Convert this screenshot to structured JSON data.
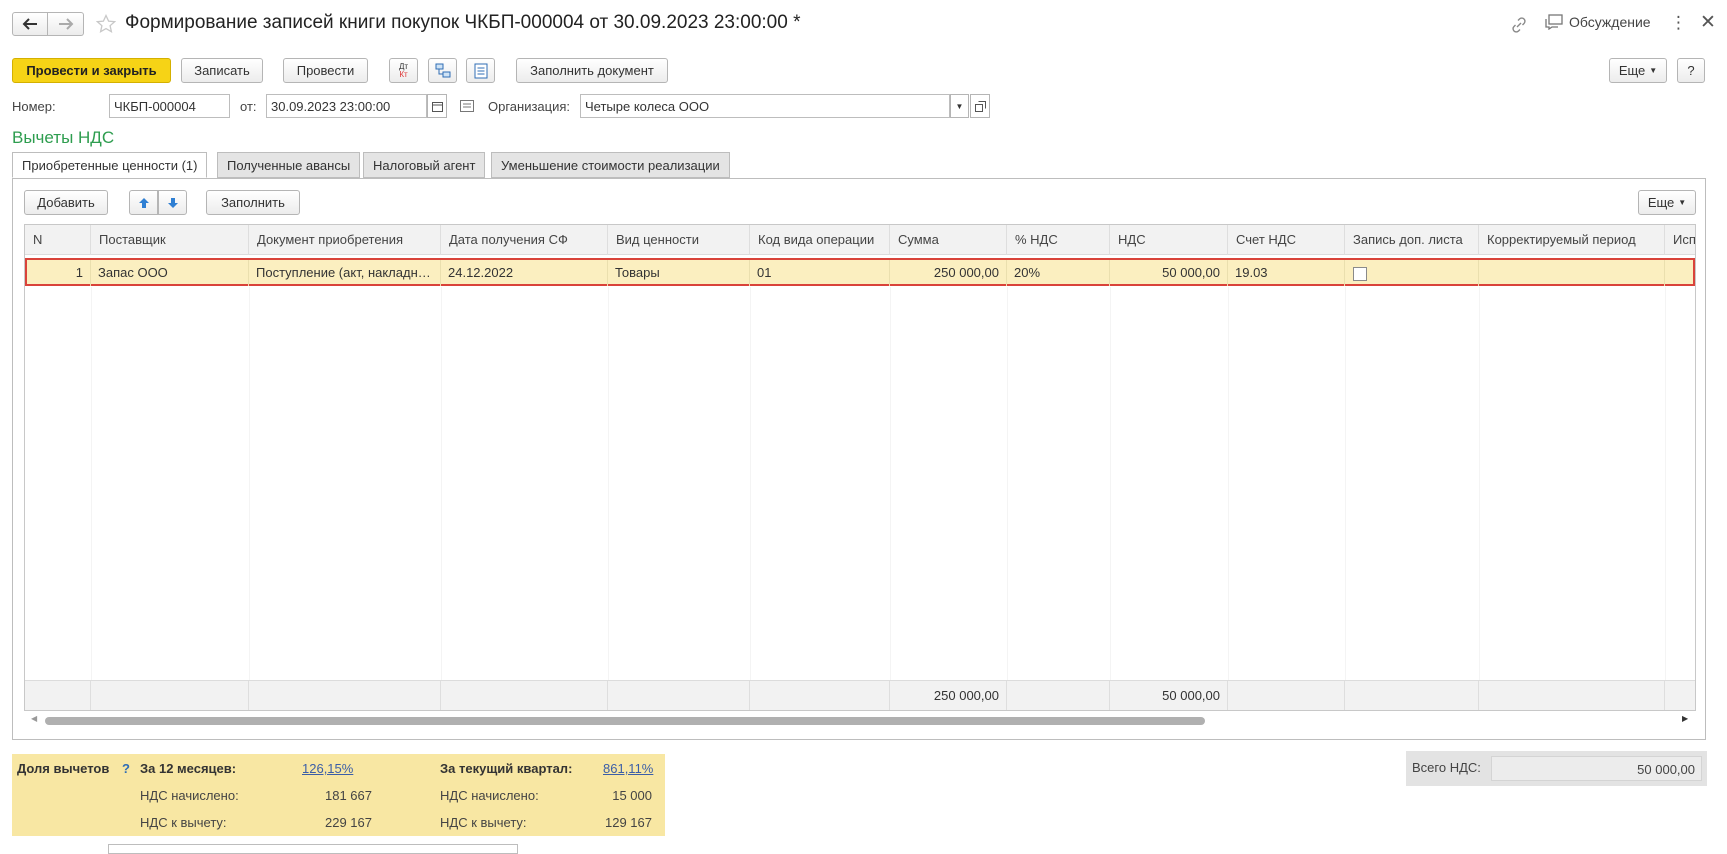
{
  "window": {
    "title": "Формирование записей книги покупок ЧКБП-000004 от 30.09.2023 23:00:00 *",
    "discussion_label": "Обсуждение"
  },
  "toolbar": {
    "post_close_label": "Провести и закрыть",
    "save_label": "Записать",
    "post_label": "Провести",
    "dt_label": "Дт",
    "kt_label": "Кт",
    "fill_doc_label": "Заполнить документ",
    "more_label": "Еще",
    "help_label": "?"
  },
  "header": {
    "number_label": "Номер:",
    "number_value": "ЧКБП-000004",
    "date_label": "от:",
    "date_value": "30.09.2023 23:00:00",
    "org_label": "Организация:",
    "org_value": "Четыре колеса ООО"
  },
  "section_title": "Вычеты НДС",
  "tabs": [
    {
      "label": "Приобретенные ценности (1)",
      "active": true
    },
    {
      "label": "Полученные авансы",
      "active": false
    },
    {
      "label": "Налоговый агент",
      "active": false
    },
    {
      "label": "Уменьшение стоимости реализации",
      "active": false
    }
  ],
  "table_toolbar": {
    "add_label": "Добавить",
    "fill_label": "Заполнить",
    "more_label": "Еще"
  },
  "table": {
    "columns": [
      "N",
      "Поставщик",
      "Документ приобретения",
      "Дата получения СФ",
      "Вид ценности",
      "Код вида операции",
      "Сумма",
      "% НДС",
      "НДС",
      "Счет НДС",
      "Запись доп. листа",
      "Корректируемый период",
      "Исп"
    ],
    "rows": [
      {
        "n": "1",
        "supplier": "Запас ООО",
        "document": "Поступление (акт, накладная...",
        "sf_date": "24.12.2022",
        "value_type": "Товары",
        "op_code": "01",
        "sum": "250 000,00",
        "vat_rate": "20%",
        "vat": "50 000,00",
        "vat_account": "19.03",
        "extra_sheet": false,
        "period": ""
      }
    ],
    "footer": {
      "sum_total": "250 000,00",
      "vat_total": "50 000,00"
    }
  },
  "summary": {
    "share_label": "Доля вычетов",
    "help_mark": "?",
    "months12_label": "За 12 месяцев:",
    "months12_value": "126,15%",
    "quarter_label": "За текущий квартал:",
    "quarter_value": "861,11%",
    "charged_label": "НДС начислено:",
    "deduct_label": "НДС к вычету:",
    "months12_charged": "181 667",
    "months12_deduct": "229 167",
    "quarter_charged": "15 000",
    "quarter_deduct": "129 167"
  },
  "total": {
    "label": "Всего НДС:",
    "value": "50 000,00"
  },
  "colors": {
    "accent_yellow": "#f6d316",
    "section_green": "#2e9d4f",
    "selected_row": "#fbefc0",
    "selected_border": "#d9433a",
    "summary_bg": "#f8e7a3"
  }
}
